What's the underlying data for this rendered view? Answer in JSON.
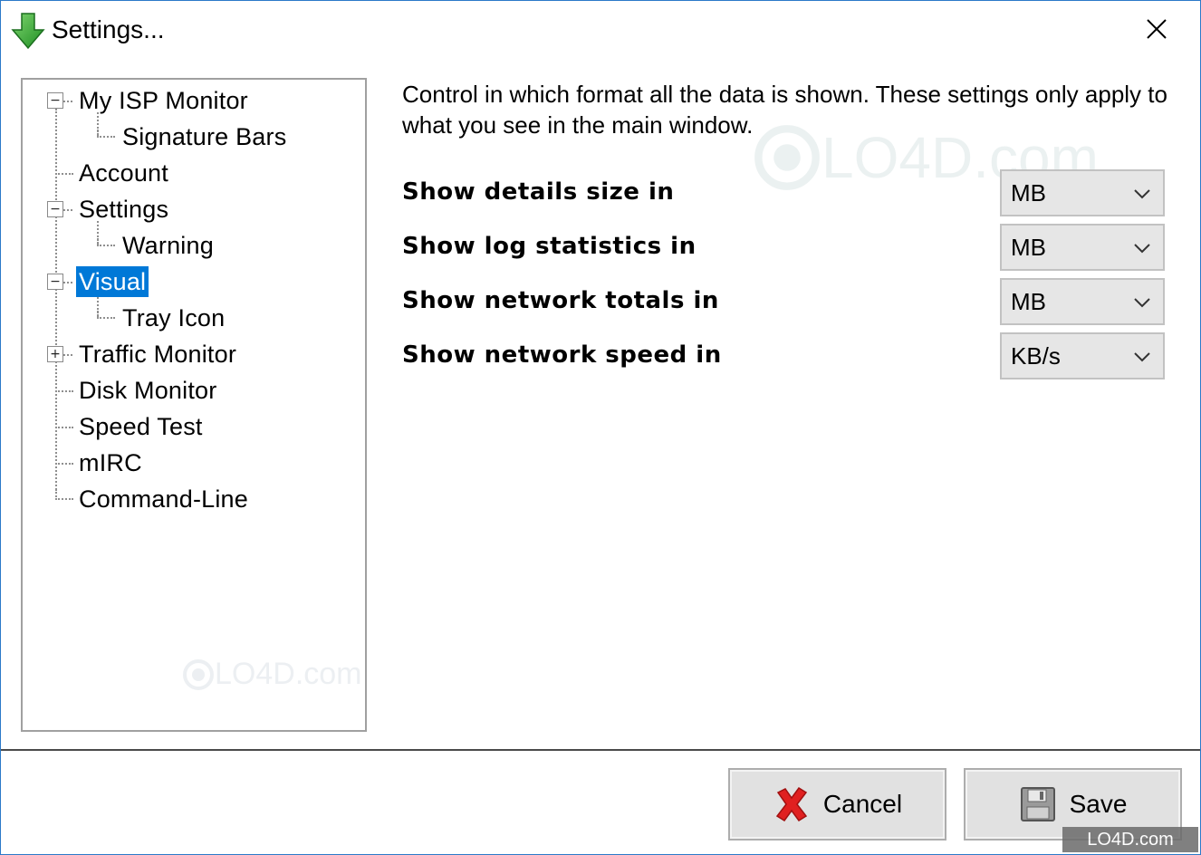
{
  "window": {
    "title": "Settings..."
  },
  "tree": {
    "items": [
      {
        "label": "My ISP Monitor",
        "expander": "−"
      },
      {
        "label": "Signature Bars"
      },
      {
        "label": "Account"
      },
      {
        "label": "Settings",
        "expander": "−"
      },
      {
        "label": "Warning"
      },
      {
        "label": "Visual",
        "expander": "−",
        "selected": true
      },
      {
        "label": "Tray Icon"
      },
      {
        "label": "Traffic Monitor",
        "expander": "+"
      },
      {
        "label": "Disk Monitor"
      },
      {
        "label": "Speed Test"
      },
      {
        "label": "mIRC"
      },
      {
        "label": "Command-Line"
      }
    ]
  },
  "content": {
    "description": "Control in which format all the data is shown. These settings only apply to what you see in the main window.",
    "settings": [
      {
        "label": "Show details size in",
        "value": "MB"
      },
      {
        "label": "Show log statistics in",
        "value": "MB"
      },
      {
        "label": "Show network totals in",
        "value": "MB"
      },
      {
        "label": "Show network speed in",
        "value": "KB/s"
      }
    ]
  },
  "buttons": {
    "cancel": "Cancel",
    "save": "Save"
  },
  "watermark": {
    "text": "LO4D.com"
  },
  "colors": {
    "selection": "#0078d7",
    "window_border": "#2b79c9",
    "app_icon": "#3cae3c",
    "cancel_icon": "#e02020"
  }
}
